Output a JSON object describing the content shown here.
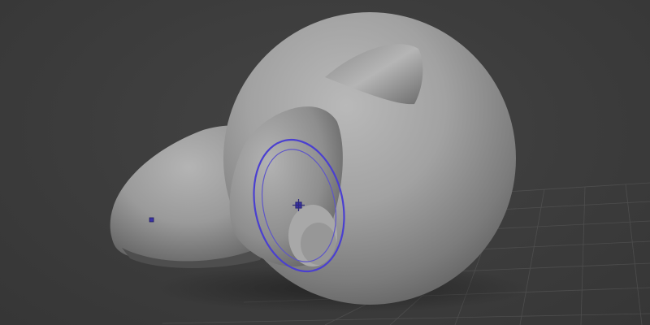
{
  "viewport": {
    "background_color": "#3b3b3b",
    "grid_color": "#5a5a5a",
    "mesh_base_color": "#9a9a9a",
    "brush_cursor_color": "#4a3fd0",
    "vertex_marker_color": "#3a32a8"
  },
  "scene": {
    "object": "sculpted-head-mesh",
    "parts": [
      "head-sphere",
      "snout",
      "ear-left",
      "ear-right"
    ],
    "tools": [
      "brush-cursor-outer-ring",
      "brush-cursor-inner-ring",
      "brush-center-marker",
      "pivot-marker"
    ]
  }
}
